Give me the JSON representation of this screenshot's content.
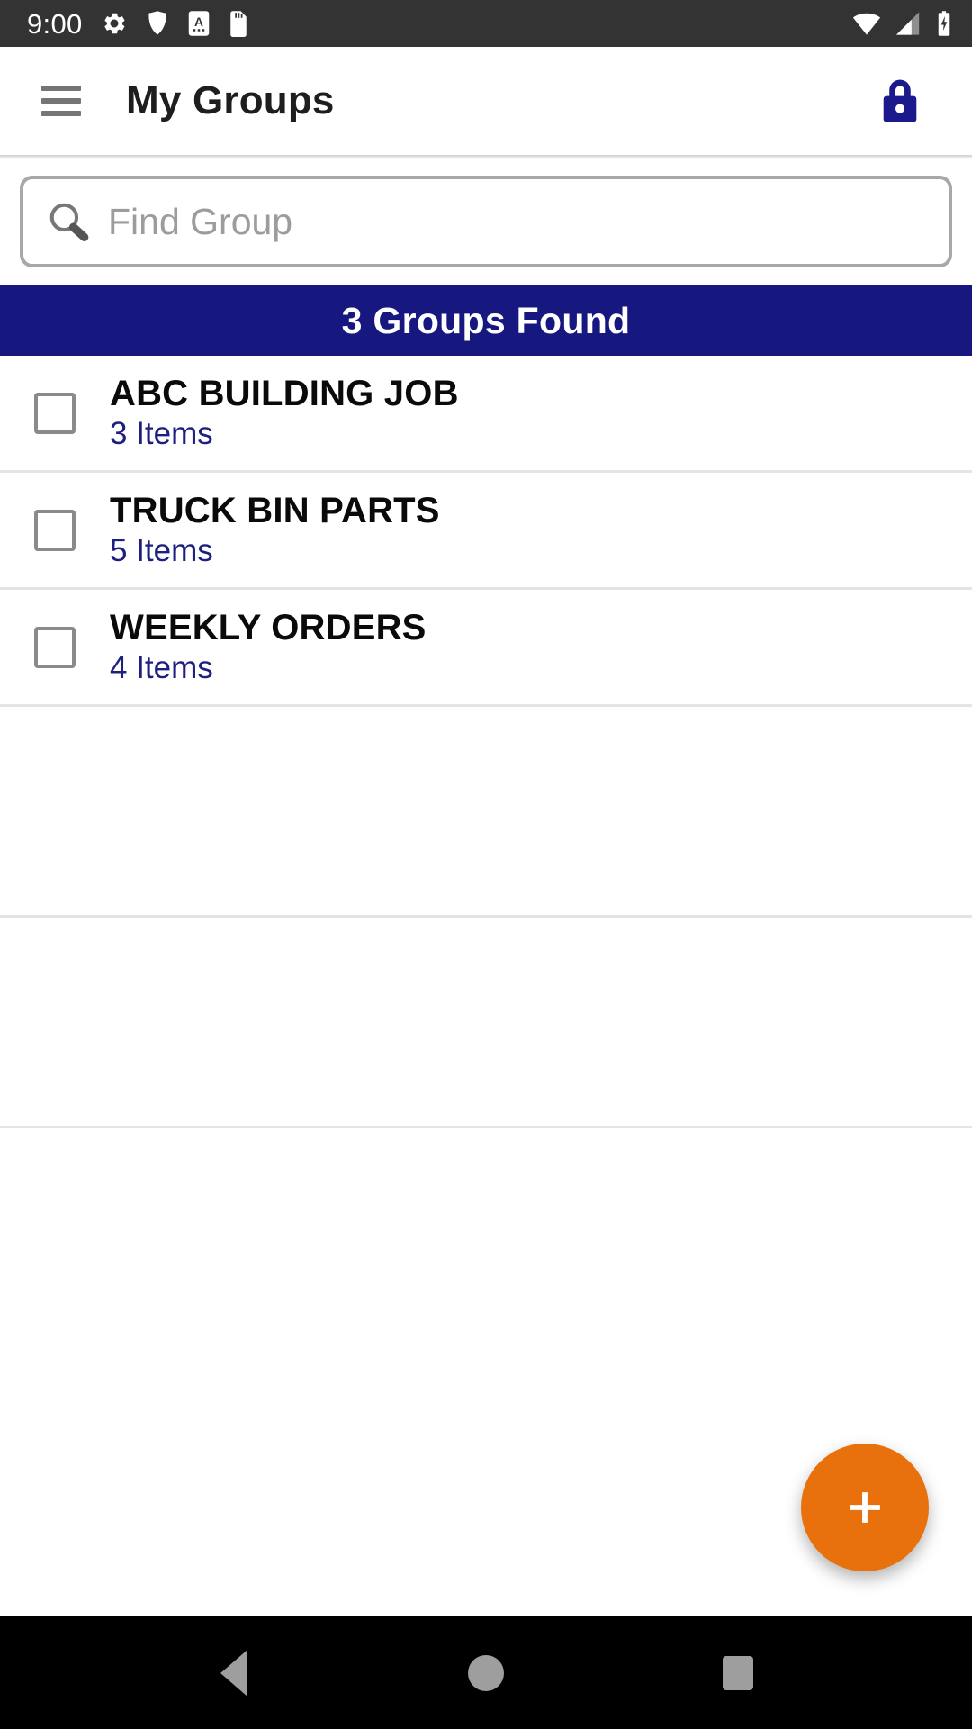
{
  "status_bar": {
    "clock": "9:00",
    "left_icons": [
      "gear-icon",
      "shield-icon",
      "a-badge-icon",
      "sd-card-icon"
    ],
    "right_icons": [
      "wifi-icon",
      "cellular-signal-icon",
      "battery-charging-icon"
    ],
    "background_color": "#333333",
    "foreground_color": "#ffffff"
  },
  "app_bar": {
    "menu_icon": "hamburger-menu-icon",
    "title": "My Groups",
    "action_icon": "lock-icon",
    "action_icon_color": "#1a1a8c",
    "title_color": "#1e1e1e",
    "background_color": "#ffffff"
  },
  "search": {
    "icon": "magnifier-icon",
    "value": "",
    "placeholder": "Find Group",
    "border_color": "#a8a8a8",
    "placeholder_color": "#9c9c9c"
  },
  "banner": {
    "text": "3 Groups Found",
    "background_color": "#17187f",
    "text_color": "#ffffff"
  },
  "groups": {
    "count": 3,
    "checkbox_color": "#8a8a8a",
    "title_color": "#0a0a0a",
    "subtitle_color": "#1e2080",
    "divider_color": "#e4e4e6",
    "rows": [
      {
        "name": "ABC BUILDING JOB",
        "items": "3 Items",
        "checked": false
      },
      {
        "name": "TRUCK BIN PARTS",
        "items": "5 Items",
        "checked": false
      },
      {
        "name": "WEEKLY ORDERS",
        "items": "4 Items",
        "checked": false
      }
    ]
  },
  "fab": {
    "icon": "plus-icon",
    "label": "+",
    "color": "#E8700D",
    "icon_color": "#ffffff"
  },
  "nav_bar": {
    "background_color": "#000000",
    "icon_color": "#9e9e9e",
    "buttons": [
      "back-icon",
      "home-icon",
      "recents-icon"
    ]
  }
}
